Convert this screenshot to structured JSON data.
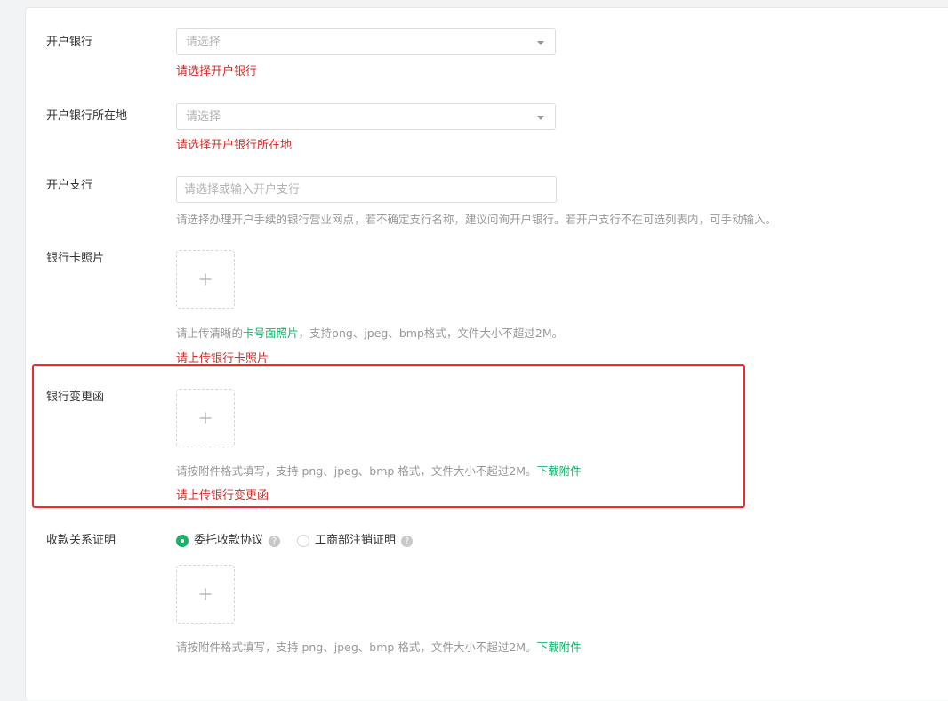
{
  "form": {
    "bank": {
      "label": "开户银行",
      "placeholder": "请选择",
      "error": "请选择开户银行"
    },
    "bank_location": {
      "label": "开户银行所在地",
      "placeholder": "请选择",
      "error": "请选择开户银行所在地"
    },
    "branch": {
      "label": "开户支行",
      "placeholder": "请选择或输入开户支行",
      "hint": "请选择办理开户手续的银行营业网点，若不确定支行名称，建议问询开户银行。若开户支行不在可选列表内，可手动输入。"
    },
    "card_photo": {
      "label": "银行卡照片",
      "hint_prefix": "请上传清晰的",
      "hint_highlight": "卡号面照片",
      "hint_suffix": "，支持png、jpeg、bmp格式，文件大小不超过2M。",
      "error": "请上传银行卡照片"
    },
    "change_letter": {
      "label": "银行变更函",
      "hint": "请按附件格式填写，支持 png、jpeg、bmp 格式，文件大小不超过2M。",
      "download_label": "下载附件",
      "error": "请上传银行变更函"
    },
    "payment_proof": {
      "label": "收款关系证明",
      "options": [
        {
          "label": "委托收款协议",
          "selected": true
        },
        {
          "label": "工商部注销证明",
          "selected": false
        }
      ],
      "hint": "请按附件格式填写，支持 png、jpeg、bmp 格式，文件大小不超过2M。",
      "download_label": "下载附件"
    }
  },
  "colors": {
    "accent": "#16b36b",
    "error": "#d0302b",
    "highlight_border": "#ee2a2a"
  }
}
